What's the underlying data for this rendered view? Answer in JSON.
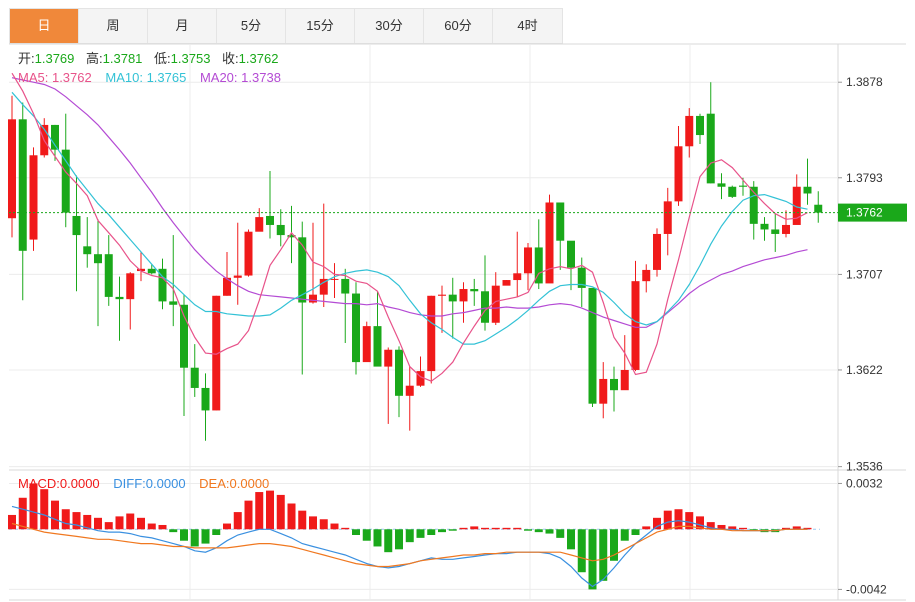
{
  "tabs": [
    "日",
    "周",
    "月",
    "5分",
    "15分",
    "30分",
    "60分",
    "4时"
  ],
  "active_tab": 0,
  "ohlc_info": {
    "open_label": "开:",
    "open": "1.3769",
    "high_label": "高:",
    "high": "1.3781",
    "low_label": "低:",
    "low": "1.3753",
    "close_label": "收:",
    "close": "1.3762"
  },
  "ma_info": {
    "ma5_label": "MA5:",
    "ma5": "1.3762",
    "ma10_label": "MA10:",
    "ma10": "1.3765",
    "ma20_label": "MA20:",
    "ma20": "1.3738"
  },
  "macd_info": {
    "macd_label": "MACD:",
    "macd": "0.0000",
    "diff_label": "DIFF:",
    "diff": "0.0000",
    "dea_label": "DEA:",
    "dea": "0.0000"
  },
  "colors": {
    "up": "#f01a1a",
    "down": "#1aa81a",
    "ma5": "#e8538a",
    "ma10": "#33c2d6",
    "ma20": "#b44bd4",
    "diff": "#3a90e0",
    "dea": "#f07820",
    "accent": "#f0883a",
    "price_tag": "#1aa81a"
  },
  "chart_data": {
    "type": "candlestick",
    "price_ticks": [
      "1.3878",
      "1.3793",
      "1.3707",
      "1.3622",
      "1.3536"
    ],
    "price_tick_values": [
      1.3878,
      1.3793,
      1.3707,
      1.3622,
      1.3536
    ],
    "last_price": "1.3762",
    "macd_ticks": [
      "0.0032",
      "-0.0042"
    ],
    "macd_tick_values": [
      0.0032,
      -0.0042
    ],
    "ylim": [
      1.3533,
      1.3912
    ],
    "macd_ylim": [
      -0.0048,
      0.004
    ],
    "candles": [
      [
        1.3757,
        1.3845,
        1.3866,
        1.374
      ],
      [
        1.3845,
        1.3728,
        1.386,
        1.3684
      ],
      [
        1.3738,
        1.3813,
        1.382,
        1.3728
      ],
      [
        1.3813,
        1.384,
        1.3846,
        1.3811
      ],
      [
        1.384,
        1.3818,
        1.384,
        1.3808
      ],
      [
        1.3818,
        1.3762,
        1.385,
        1.3749
      ],
      [
        1.3759,
        1.3742,
        1.3795,
        1.3692
      ],
      [
        1.3732,
        1.3725,
        1.3758,
        1.3713
      ],
      [
        1.3725,
        1.3717,
        1.3756,
        1.3661
      ],
      [
        1.3725,
        1.3687,
        1.3742,
        1.3679
      ],
      [
        1.3687,
        1.3685,
        1.3705,
        1.3648
      ],
      [
        1.3685,
        1.3708,
        1.3709,
        1.3658
      ],
      [
        1.371,
        1.3712,
        1.3727,
        1.3701
      ],
      [
        1.3712,
        1.3708,
        1.3716,
        1.3707
      ],
      [
        1.3712,
        1.3683,
        1.3721,
        1.3676
      ],
      [
        1.3683,
        1.368,
        1.3742,
        1.3661
      ],
      [
        1.368,
        1.3624,
        1.3689,
        1.3581
      ],
      [
        1.3624,
        1.3606,
        1.3645,
        1.3598
      ],
      [
        1.3606,
        1.3586,
        1.3619,
        1.3559
      ],
      [
        1.3586,
        1.3688,
        1.3688,
        1.3586
      ],
      [
        1.3688,
        1.3704,
        1.3727,
        1.3688
      ],
      [
        1.3704,
        1.3706,
        1.3753,
        1.368
      ],
      [
        1.3706,
        1.3745,
        1.3747,
        1.3705
      ],
      [
        1.3745,
        1.3758,
        1.3766,
        1.3749
      ],
      [
        1.3759,
        1.3751,
        1.3799,
        1.3739
      ],
      [
        1.3751,
        1.3742,
        1.3765,
        1.3732
      ],
      [
        1.3742,
        1.374,
        1.3768,
        1.3717
      ],
      [
        1.374,
        1.3682,
        1.3754,
        1.3618
      ],
      [
        1.3682,
        1.3689,
        1.3753,
        1.3681
      ],
      [
        1.3689,
        1.3703,
        1.377,
        1.3678
      ],
      [
        1.3703,
        1.3703,
        1.3717,
        1.3686
      ],
      [
        1.3703,
        1.369,
        1.3712,
        1.3646
      ],
      [
        1.369,
        1.3629,
        1.37,
        1.3618
      ],
      [
        1.3629,
        1.3661,
        1.3665,
        1.363
      ],
      [
        1.3661,
        1.3625,
        1.3692,
        1.3628
      ],
      [
        1.3625,
        1.364,
        1.3642,
        1.3574
      ],
      [
        1.364,
        1.3599,
        1.3643,
        1.358
      ],
      [
        1.3599,
        1.3608,
        1.3625,
        1.3568
      ],
      [
        1.3608,
        1.3621,
        1.3634,
        1.3607
      ],
      [
        1.3621,
        1.3688,
        1.3688,
        1.361
      ],
      [
        1.3688,
        1.3689,
        1.3697,
        1.3655
      ],
      [
        1.3689,
        1.3683,
        1.3704,
        1.365
      ],
      [
        1.3683,
        1.3694,
        1.37,
        1.3664
      ],
      [
        1.3694,
        1.3692,
        1.3703,
        1.3679
      ],
      [
        1.3692,
        1.3664,
        1.3724,
        1.3657
      ],
      [
        1.3664,
        1.3697,
        1.3709,
        1.3662
      ],
      [
        1.3697,
        1.3702,
        1.3702,
        1.3699
      ],
      [
        1.3702,
        1.3708,
        1.3745,
        1.3687
      ],
      [
        1.3708,
        1.3731,
        1.3735,
        1.3693
      ],
      [
        1.3731,
        1.3699,
        1.3756,
        1.3694
      ],
      [
        1.3699,
        1.3771,
        1.3778,
        1.3704
      ],
      [
        1.3771,
        1.3737,
        1.3769,
        1.3711
      ],
      [
        1.3737,
        1.3713,
        1.3724,
        1.3693
      ],
      [
        1.3713,
        1.3695,
        1.3722,
        1.3678
      ],
      [
        1.3695,
        1.3592,
        1.3691,
        1.3589
      ],
      [
        1.3592,
        1.3614,
        1.3629,
        1.3579
      ],
      [
        1.3614,
        1.3604,
        1.3625,
        1.3585
      ],
      [
        1.3604,
        1.3622,
        1.3653,
        1.3621
      ],
      [
        1.3622,
        1.3701,
        1.3719,
        1.3621
      ],
      [
        1.3701,
        1.3711,
        1.3716,
        1.3691
      ],
      [
        1.3711,
        1.3743,
        1.3748,
        1.3705
      ],
      [
        1.3743,
        1.3772,
        1.3784,
        1.3724
      ],
      [
        1.3772,
        1.3821,
        1.3839,
        1.3768
      ],
      [
        1.3821,
        1.3848,
        1.3855,
        1.3811
      ],
      [
        1.3848,
        1.3831,
        1.385,
        1.3823
      ],
      [
        1.385,
        1.3788,
        1.3878,
        1.3788
      ],
      [
        1.3788,
        1.3785,
        1.3797,
        1.3774
      ],
      [
        1.3785,
        1.3776,
        1.3786,
        1.3775
      ],
      [
        1.3786,
        1.3785,
        1.3793,
        1.3777
      ],
      [
        1.3785,
        1.3752,
        1.379,
        1.3738
      ],
      [
        1.3752,
        1.3747,
        1.3758,
        1.3737
      ],
      [
        1.3747,
        1.3743,
        1.3761,
        1.3727
      ],
      [
        1.3743,
        1.3751,
        1.3764,
        1.374
      ],
      [
        1.3751,
        1.3785,
        1.3796,
        1.3754
      ],
      [
        1.3785,
        1.3779,
        1.381,
        1.3769
      ],
      [
        1.3769,
        1.3762,
        1.3781,
        1.3753
      ]
    ],
    "ma5": [
      1.3886,
      1.387,
      1.385,
      1.3826,
      1.3812,
      1.3798,
      1.3788,
      1.3777,
      1.3755,
      1.3744,
      1.3733,
      1.3719,
      1.371,
      1.3706,
      1.3704,
      1.3694,
      1.367,
      1.3651,
      1.3637,
      1.3636,
      1.3641,
      1.3645,
      1.3657,
      1.3684,
      1.3715,
      1.3729,
      1.3744,
      1.3733,
      1.3718,
      1.3714,
      1.3707,
      1.3706,
      1.3701,
      1.3699,
      1.3692,
      1.3669,
      1.3648,
      1.3625,
      1.3616,
      1.3612,
      1.3619,
      1.3629,
      1.3646,
      1.3661,
      1.3675,
      1.3683,
      1.3685,
      1.3687,
      1.3691,
      1.3708,
      1.3712,
      1.3714,
      1.3712,
      1.3715,
      1.3709,
      1.3682,
      1.3651,
      1.3637,
      1.3618,
      1.362,
      1.3645,
      1.3685,
      1.372,
      1.3758,
      1.3794,
      1.3806,
      1.3809,
      1.3802,
      1.3791,
      1.378,
      1.377,
      1.3761,
      1.3756,
      1.3757,
      1.3762
    ],
    "ma10": [
      1.3869,
      1.3858,
      1.3848,
      1.3836,
      1.3822,
      1.3808,
      1.3794,
      1.3782,
      1.377,
      1.376,
      1.3749,
      1.3738,
      1.3727,
      1.3716,
      1.3705,
      1.3698,
      1.3689,
      1.368,
      1.3674,
      1.3674,
      1.3672,
      1.3671,
      1.367,
      1.367,
      1.3671,
      1.3677,
      1.3684,
      1.3689,
      1.3694,
      1.37,
      1.3705,
      1.3708,
      1.371,
      1.3711,
      1.3709,
      1.3705,
      1.3697,
      1.3684,
      1.3672,
      1.3664,
      1.3658,
      1.3651,
      1.3645,
      1.3645,
      1.3648,
      1.3654,
      1.366,
      1.3667,
      1.3675,
      1.3684,
      1.3692,
      1.3697,
      1.3698,
      1.3698,
      1.3696,
      1.3691,
      1.3682,
      1.3672,
      1.3665,
      1.3662,
      1.3665,
      1.3674,
      1.3684,
      1.3698,
      1.3715,
      1.3734,
      1.375,
      1.3763,
      1.3773,
      1.3777,
      1.3778,
      1.3775,
      1.3772,
      1.3767,
      1.3765
    ],
    "ma20": [
      1.3882,
      1.388,
      1.3878,
      1.3876,
      1.3872,
      1.3865,
      1.3857,
      1.3849,
      1.384,
      1.3829,
      1.3818,
      1.3806,
      1.3793,
      1.378,
      1.3766,
      1.3753,
      1.3741,
      1.3729,
      1.3719,
      1.371,
      1.3703,
      1.3697,
      1.3692,
      1.3689,
      1.3688,
      1.3687,
      1.3686,
      1.3685,
      1.3684,
      1.3683,
      1.3682,
      1.3681,
      1.3681,
      1.368,
      1.3681,
      1.3678,
      1.3676,
      1.3673,
      1.3671,
      1.367,
      1.367,
      1.3672,
      1.3673,
      1.3675,
      1.3677,
      1.3677,
      1.3678,
      1.3677,
      1.3677,
      1.3678,
      1.368,
      1.3681,
      1.368,
      1.3677,
      1.3673,
      1.3669,
      1.3666,
      1.3663,
      1.366,
      1.366,
      1.3665,
      1.3673,
      1.3681,
      1.369,
      1.3697,
      1.3702,
      1.3707,
      1.371,
      1.3714,
      1.3717,
      1.372,
      1.3722,
      1.3724,
      1.3727,
      1.3729
    ],
    "macd_hist": [
      0.001,
      0.0022,
      0.0032,
      0.0028,
      0.002,
      0.0014,
      0.0012,
      0.001,
      0.0008,
      0.0005,
      0.0009,
      0.0011,
      0.0008,
      0.0004,
      0.0003,
      -0.0002,
      -0.0008,
      -0.0012,
      -0.001,
      -0.0004,
      0.0004,
      0.0012,
      0.002,
      0.0026,
      0.0027,
      0.0024,
      0.0018,
      0.0013,
      0.0009,
      0.0007,
      0.0004,
      0.0001,
      -0.0004,
      -0.0008,
      -0.0012,
      -0.0016,
      -0.0014,
      -0.0009,
      -0.0006,
      -0.0004,
      -0.0002,
      -0.0001,
      0.0001,
      0.0002,
      0.0001,
      0.0001,
      0.0001,
      0.0001,
      -0.0001,
      -0.0002,
      -0.0003,
      -0.0006,
      -0.0014,
      -0.003,
      -0.0042,
      -0.0036,
      -0.0022,
      -0.0008,
      -0.0004,
      0.0002,
      0.0008,
      0.0013,
      0.0014,
      0.0012,
      0.0009,
      0.0005,
      0.0003,
      0.0002,
      0.0001,
      -0.0001,
      -0.0002,
      -0.0002,
      0.0001,
      0.0002,
      0.0001
    ],
    "diff": [
      0.0016,
      0.0014,
      0.0012,
      0.001,
      0.0007,
      0.0004,
      0.0003,
      0.0001,
      -0.0001,
      -0.0002,
      -0.0002,
      -0.0003,
      -0.0005,
      -0.0006,
      -0.0008,
      -0.001,
      -0.0012,
      -0.0015,
      -0.0016,
      -0.0013,
      -0.0008,
      -0.0004,
      -0.0002,
      0.0,
      0.0,
      -0.0003,
      -0.0006,
      -0.001,
      -0.0012,
      -0.0014,
      -0.0016,
      -0.0018,
      -0.0021,
      -0.0024,
      -0.0026,
      -0.0027,
      -0.0026,
      -0.0024,
      -0.0022,
      -0.002,
      -0.0021,
      -0.0021,
      -0.002,
      -0.0019,
      -0.0018,
      -0.0017,
      -0.0017,
      -0.0016,
      -0.0016,
      -0.0016,
      -0.0017,
      -0.002,
      -0.0026,
      -0.0034,
      -0.004,
      -0.0035,
      -0.0027,
      -0.0018,
      -0.001,
      -0.0004,
      0.0002,
      0.0005,
      0.0006,
      0.0005,
      0.0003,
      0.0001,
      0.0,
      0.0,
      -0.0001,
      -0.0001,
      -0.0001,
      -0.0001,
      0.0,
      0.0,
      0.0
    ],
    "dea": [
      0.0004,
      0.0002,
      0.0,
      -0.0002,
      -0.0003,
      -0.0004,
      -0.0005,
      -0.0006,
      -0.0007,
      -0.0007,
      -0.0008,
      -0.0009,
      -0.001,
      -0.001,
      -0.0011,
      -0.0012,
      -0.0012,
      -0.0013,
      -0.0013,
      -0.0013,
      -0.0013,
      -0.0012,
      -0.0011,
      -0.001,
      -0.001,
      -0.0011,
      -0.0012,
      -0.0014,
      -0.0016,
      -0.0018,
      -0.002,
      -0.0022,
      -0.0024,
      -0.0025,
      -0.0026,
      -0.0026,
      -0.0025,
      -0.0024,
      -0.0022,
      -0.0021,
      -0.002,
      -0.0019,
      -0.0018,
      -0.0018,
      -0.0017,
      -0.0017,
      -0.0016,
      -0.0016,
      -0.0016,
      -0.0016,
      -0.0016,
      -0.0016,
      -0.0018,
      -0.002,
      -0.0022,
      -0.0021,
      -0.0018,
      -0.0014,
      -0.001,
      -0.0006,
      -0.0002,
      0.0,
      0.0002,
      0.0002,
      0.0001,
      0.0,
      0.0,
      -0.0001,
      -0.0001,
      -0.0001,
      -0.0001,
      -0.0001,
      0.0,
      0.0,
      0.0
    ],
    "grid": true
  }
}
